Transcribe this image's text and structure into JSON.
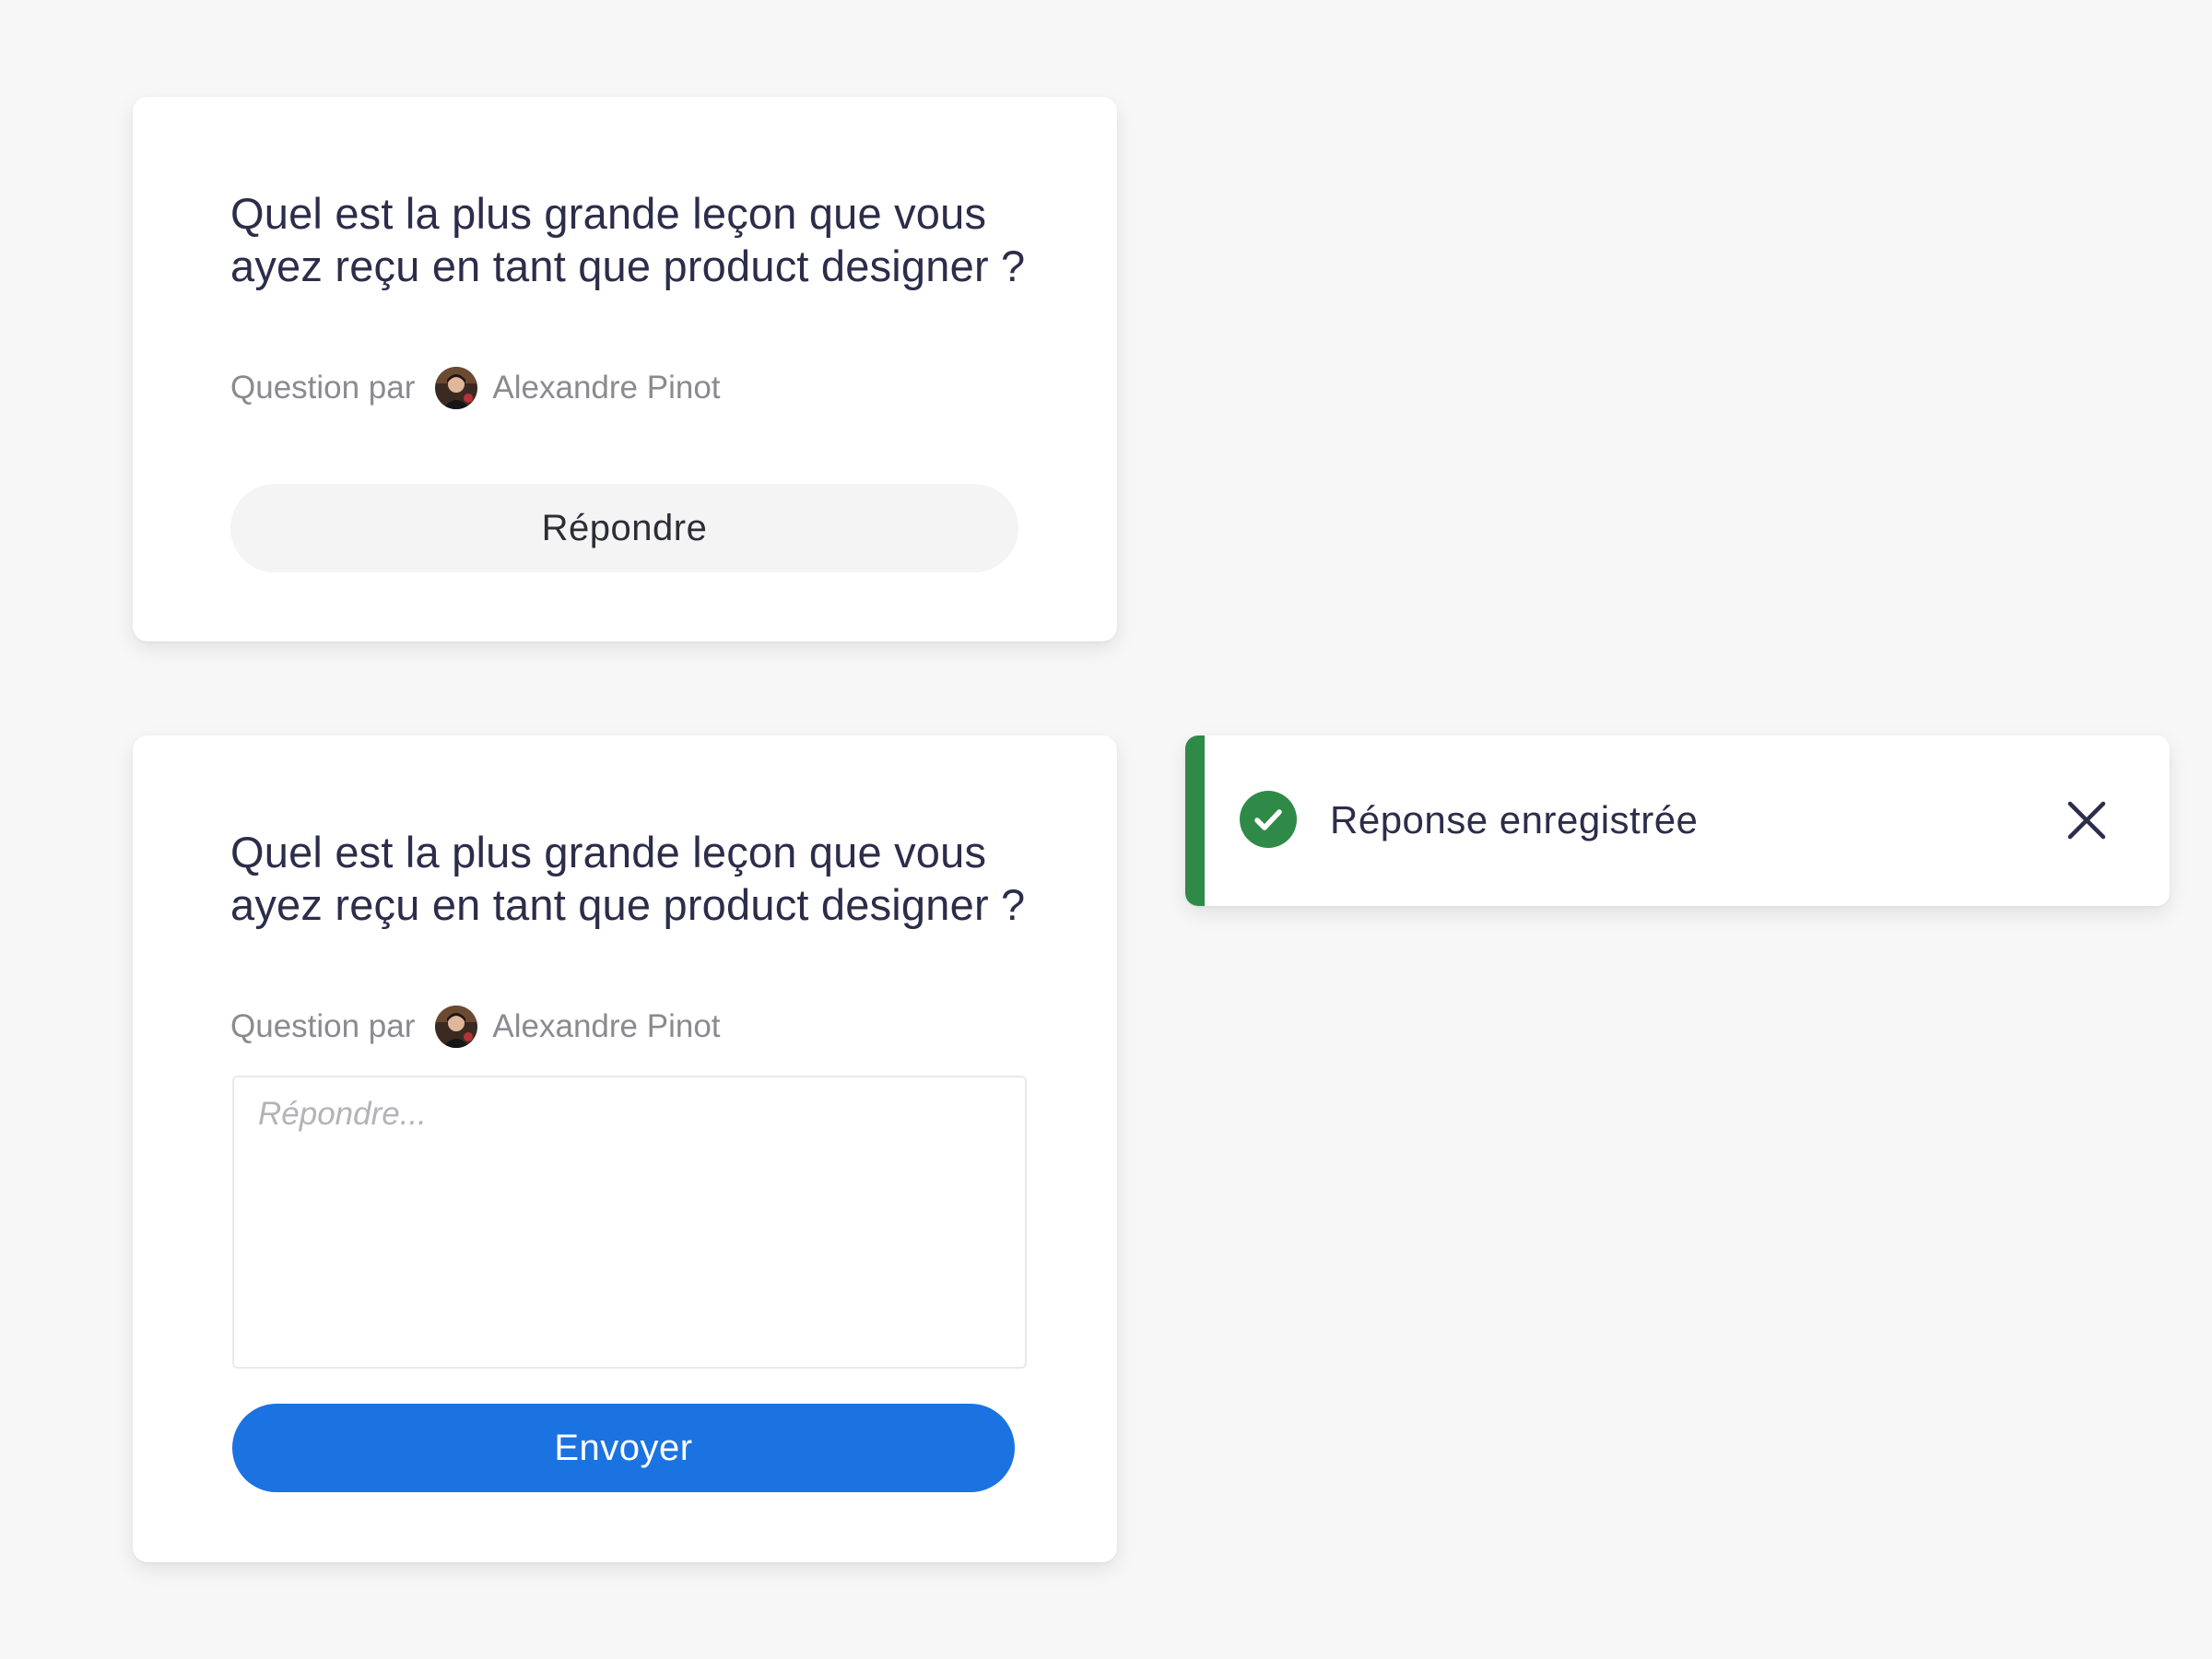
{
  "cards": [
    {
      "question": "Quel est la plus grande leçon que vous ayez reçu en tant que product designer ?",
      "byline_label": "Question par",
      "author": "Alexandre Pinot",
      "reply_button": "Répondre"
    },
    {
      "question": "Quel est la plus grande leçon que vous ayez reçu en tant que product designer ?",
      "byline_label": "Question par",
      "author": "Alexandre Pinot",
      "textarea_placeholder": "Répondre...",
      "textarea_value": "",
      "send_button": "Envoyer"
    }
  ],
  "toast": {
    "message": "Réponse enregistrée",
    "status": "success",
    "icon": "check-circle-icon",
    "close_icon": "close-icon"
  },
  "colors": {
    "background": "#f7f7f7",
    "card": "#ffffff",
    "primary": "#1a73e0",
    "success": "#2f8a48",
    "text_dark": "#2c2d4a",
    "text_muted": "#8a8a8f"
  }
}
